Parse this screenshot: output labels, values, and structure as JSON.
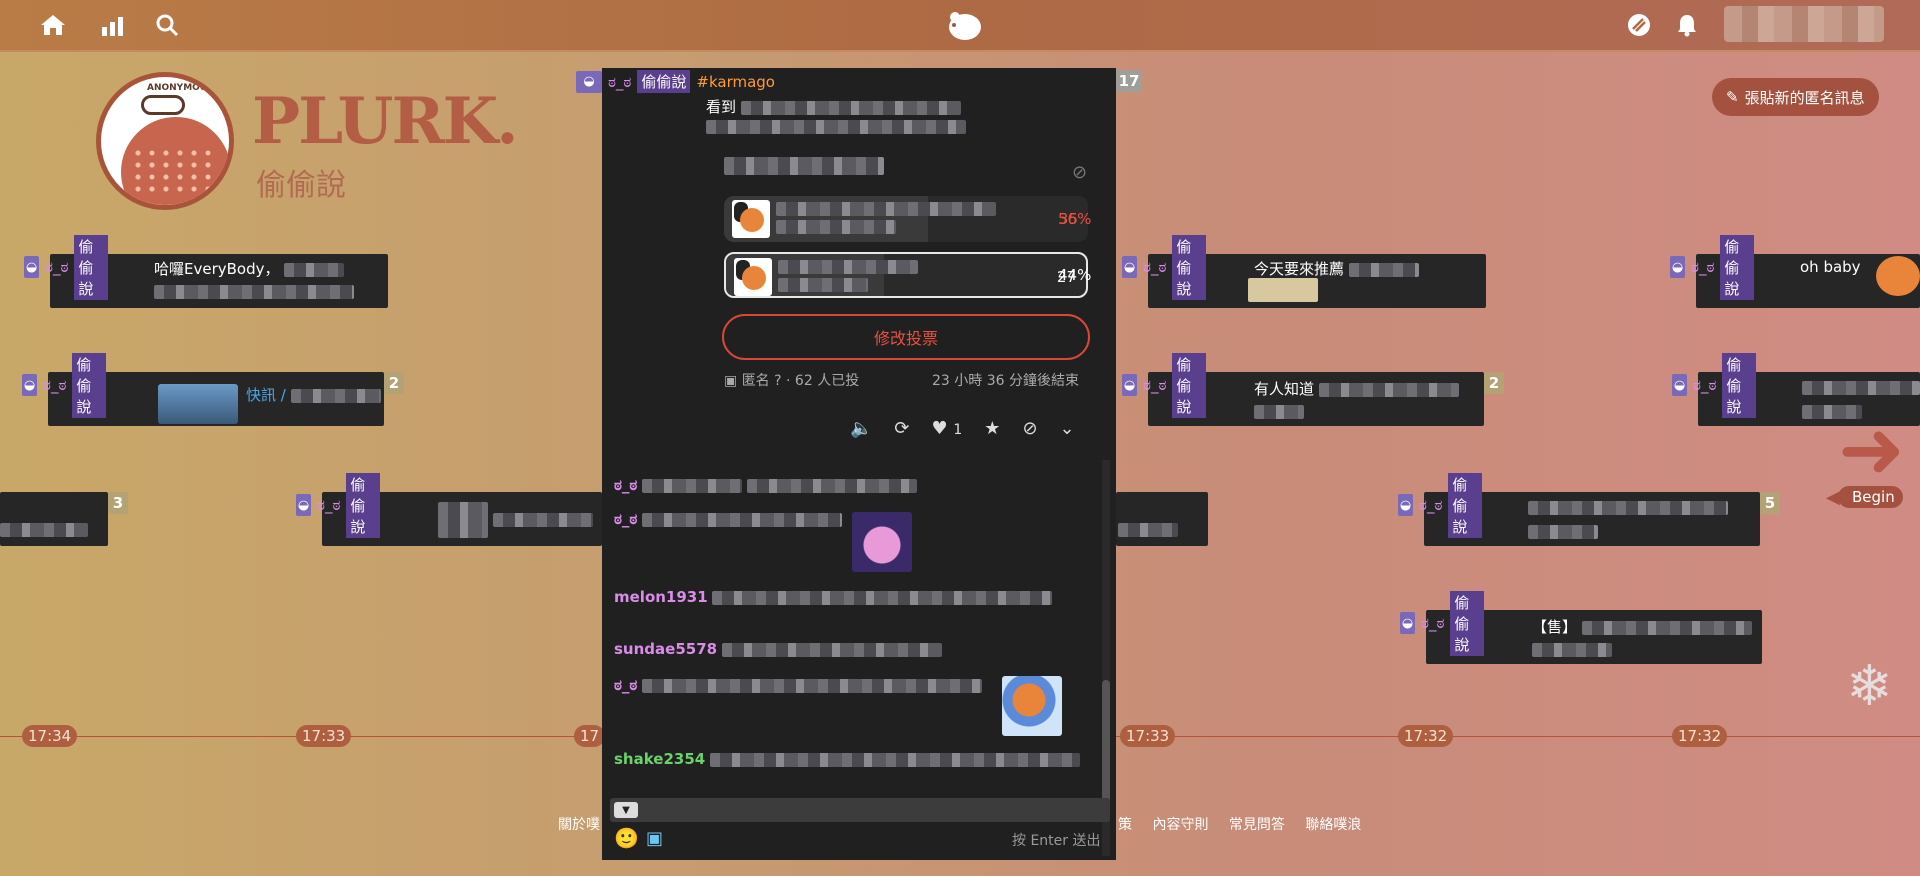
{
  "brand": {
    "word": "PLURK.",
    "sub": "偷偷說",
    "logo_text": "ANONYMOUS"
  },
  "header": {
    "new_anon_label": "張貼新的匿名訊息"
  },
  "anon": {
    "mask": "ಠ_ಠ",
    "qualifier": "偷偷說"
  },
  "timeline_bubbles": [
    {
      "text": "哈囉EveryBody，"
    },
    {
      "text": "快訊 /",
      "count": "2"
    },
    {
      "text": "",
      "count": "3"
    },
    {
      "text": ""
    },
    {
      "text": "今天要來推薦"
    },
    {
      "text": "有人知道",
      "count": "2"
    },
    {
      "text": "",
      "count": "5"
    },
    {
      "text": "【售】"
    },
    {
      "text": "oh baby"
    },
    {
      "text": ""
    }
  ],
  "times": [
    "17:34",
    "17:33",
    "17",
    "17:33",
    "17:32",
    "17:32"
  ],
  "begin_label": "Begin",
  "footer_links": [
    "關於噗",
    "策",
    "內容守則",
    "常見問答",
    "聯絡噗浪"
  ],
  "popup": {
    "tag": "#karmago",
    "body_first": "看到",
    "count": "17",
    "poll": {
      "options": [
        {
          "votes": "35",
          "percent": "56%",
          "fraction": 0.56,
          "selected": false
        },
        {
          "votes": "27",
          "percent": "44%",
          "fraction": 0.44,
          "selected": true
        }
      ],
      "vote_button": "修改投票",
      "meta": "匿名",
      "voters": "· 62 人已投",
      "ends": "23 小時 36 分鐘後結束"
    },
    "like_count": "1",
    "responses": [
      {
        "name": "ಠ_ಠ",
        "color": "#d98ce8"
      },
      {
        "name": "ಠ_ಠ",
        "color": "#d98ce8"
      },
      {
        "name": "melon1931",
        "color": "#d98ce8"
      },
      {
        "name": "sundae5578",
        "color": "#d98ce8"
      },
      {
        "name": "ಠ_ಠ",
        "color": "#d98ce8"
      },
      {
        "name": "shake2354",
        "color": "#6cd06c"
      }
    ],
    "send_hint": "按 Enter 送出"
  }
}
